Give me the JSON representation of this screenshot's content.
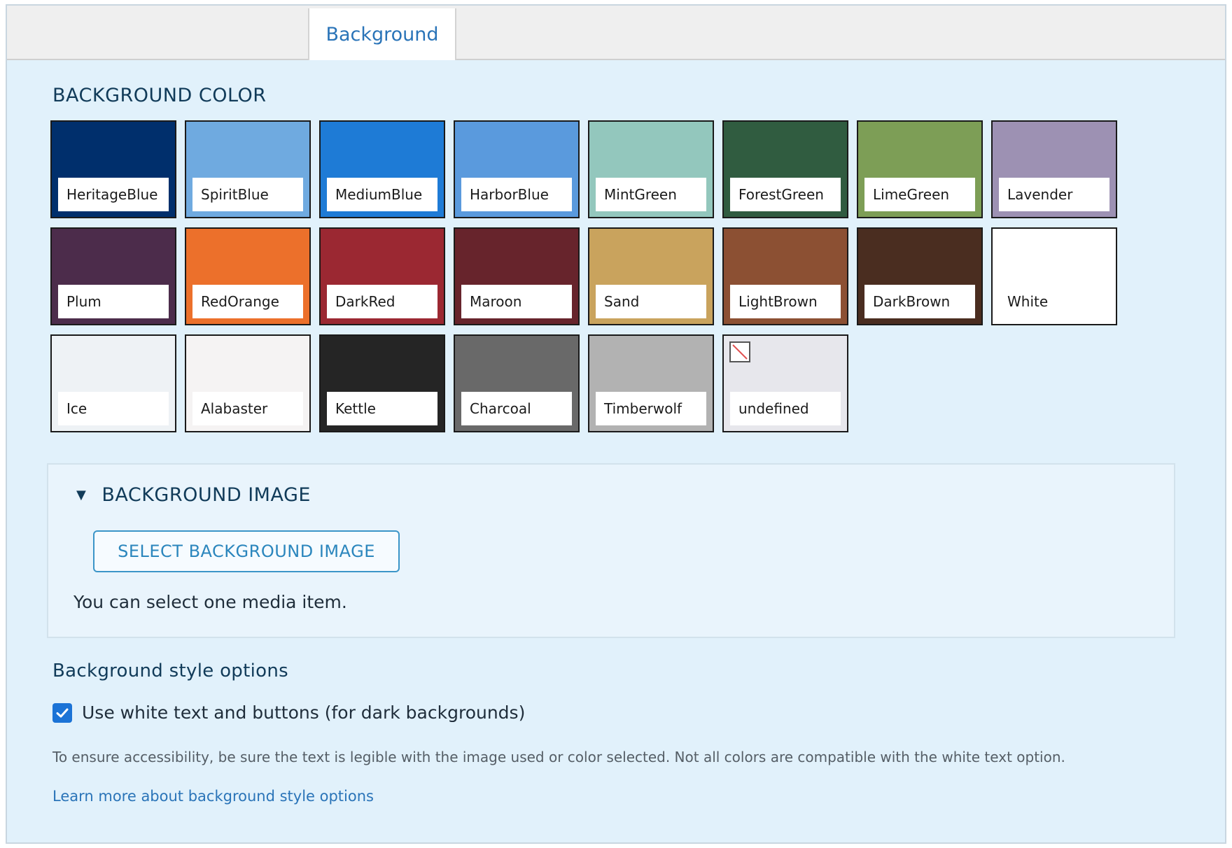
{
  "tabs": [
    {
      "label": "Background",
      "active": true
    }
  ],
  "background_color": {
    "title": "BACKGROUND COLOR",
    "swatches": [
      {
        "label": "HeritageBlue",
        "color": "#002f6c"
      },
      {
        "label": "SpiritBlue",
        "color": "#6faae0"
      },
      {
        "label": "MediumBlue",
        "color": "#1e7bd6"
      },
      {
        "label": "HarborBlue",
        "color": "#5a9add"
      },
      {
        "label": "MintGreen",
        "color": "#93c7bd"
      },
      {
        "label": "ForestGreen",
        "color": "#305c40"
      },
      {
        "label": "LimeGreen",
        "color": "#7d9e56"
      },
      {
        "label": "Lavender",
        "color": "#9d91b3"
      },
      {
        "label": "Plum",
        "color": "#4c2c4b"
      },
      {
        "label": "RedOrange",
        "color": "#ec702b"
      },
      {
        "label": "DarkRed",
        "color": "#9b2832"
      },
      {
        "label": "Maroon",
        "color": "#67242c"
      },
      {
        "label": "Sand",
        "color": "#c9a35d"
      },
      {
        "label": "LightBrown",
        "color": "#8c5033"
      },
      {
        "label": "DarkBrown",
        "color": "#4a2d20"
      },
      {
        "label": "White",
        "color": "#ffffff"
      },
      {
        "label": "Ice",
        "color": "#eef2f5"
      },
      {
        "label": "Alabaster",
        "color": "#f5f3f3"
      },
      {
        "label": "Kettle",
        "color": "#252525"
      },
      {
        "label": "Charcoal",
        "color": "#696969"
      },
      {
        "label": "Timberwolf",
        "color": "#b2b2b2"
      },
      {
        "label": "undefined",
        "color": "#e7e7ec",
        "broken_image": true
      }
    ]
  },
  "background_image": {
    "legend": "BACKGROUND IMAGE",
    "expanded": true,
    "button_label": "SELECT BACKGROUND IMAGE",
    "help": "You can select one media item."
  },
  "style_options": {
    "heading": "Background style options",
    "checkbox_label": "Use white text and buttons (for dark backgrounds)",
    "checkbox_checked": true,
    "description": "To ensure accessibility, be sure the text is legible with the image used or color selected. Not all colors are compatible with the white text option.",
    "link": "Learn more about background style options"
  },
  "colors": {
    "accent": "#2a74b8",
    "panel": "#e1f1fb",
    "checkbox": "#1b73d6"
  }
}
